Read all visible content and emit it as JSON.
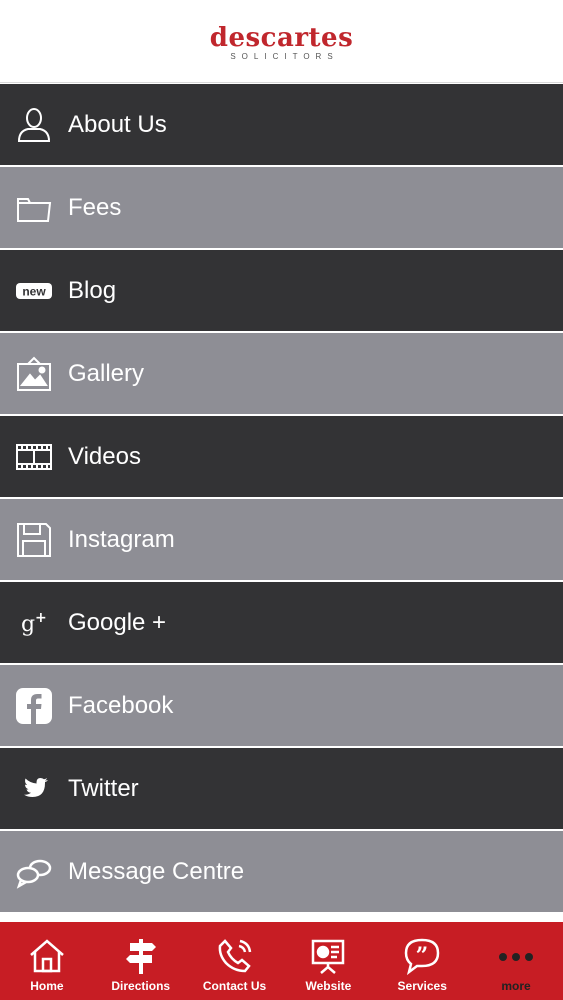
{
  "header": {
    "logo_name": "descartes",
    "logo_sub": "SOLICITORS"
  },
  "menu": {
    "items": [
      {
        "label": "About Us",
        "icon": "person-icon"
      },
      {
        "label": "Fees",
        "icon": "folder-icon"
      },
      {
        "label": "Blog",
        "icon": "new-badge-icon"
      },
      {
        "label": "Gallery",
        "icon": "picture-frame-icon"
      },
      {
        "label": "Videos",
        "icon": "film-strip-icon"
      },
      {
        "label": "Instagram",
        "icon": "floppy-disk-icon"
      },
      {
        "label": "Google +",
        "icon": "google-plus-icon"
      },
      {
        "label": "Facebook",
        "icon": "facebook-icon"
      },
      {
        "label": "Twitter",
        "icon": "twitter-bird-icon"
      },
      {
        "label": "Message Centre",
        "icon": "chat-bubbles-icon"
      }
    ],
    "new_badge_text": "new"
  },
  "tabbar": {
    "tabs": [
      {
        "label": "Home",
        "icon": "house-icon"
      },
      {
        "label": "Directions",
        "icon": "signpost-icon"
      },
      {
        "label": "Contact Us",
        "icon": "phone-icon"
      },
      {
        "label": "Website",
        "icon": "presentation-board-icon"
      },
      {
        "label": "Services",
        "icon": "quote-bubble-icon"
      },
      {
        "label": "more",
        "icon": "more-dots-icon"
      }
    ],
    "active": "more"
  },
  "colors": {
    "brand_red": "#c71d24",
    "logo_red": "#c0272d",
    "row_dark": "#333335",
    "row_light": "#8e8e95"
  }
}
